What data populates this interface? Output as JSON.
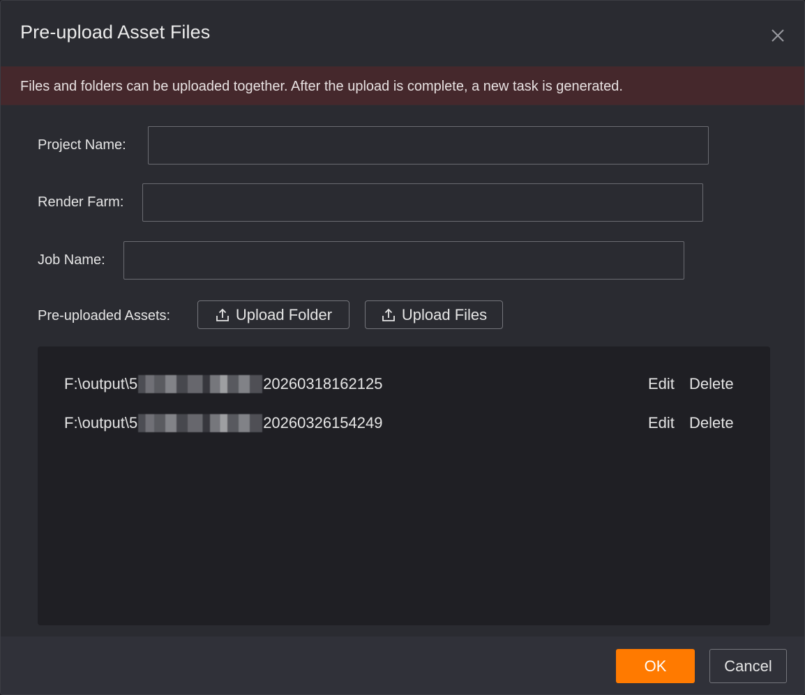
{
  "dialog": {
    "title": "Pre-upload Asset Files",
    "close_icon": "close-icon"
  },
  "notice": {
    "text": "Files and folders can be uploaded together. After the upload is complete, a new task is generated."
  },
  "form": {
    "project_name": {
      "label": "Project Name:",
      "value": ""
    },
    "render_farm": {
      "label": "Render Farm:",
      "value": ""
    },
    "job_name": {
      "label": "Job Name:",
      "value": ""
    },
    "assets_label": "Pre-uploaded Assets:"
  },
  "buttons": {
    "upload_folder": "Upload Folder",
    "upload_files": "Upload Files",
    "upload_icon": "upload-icon",
    "ok": "OK",
    "cancel": "Cancel"
  },
  "assets": [
    {
      "path_prefix": "F:\\output\\5",
      "path_suffix": "20260318162125",
      "edit": "Edit",
      "delete": "Delete"
    },
    {
      "path_prefix": "F:\\output\\5",
      "path_suffix": "20260326154249",
      "edit": "Edit",
      "delete": "Delete"
    }
  ],
  "colors": {
    "accent": "#ff7a00",
    "notice_bg": "#45282c",
    "dialog_bg": "#2a2b31",
    "list_bg": "#1f1f24"
  }
}
